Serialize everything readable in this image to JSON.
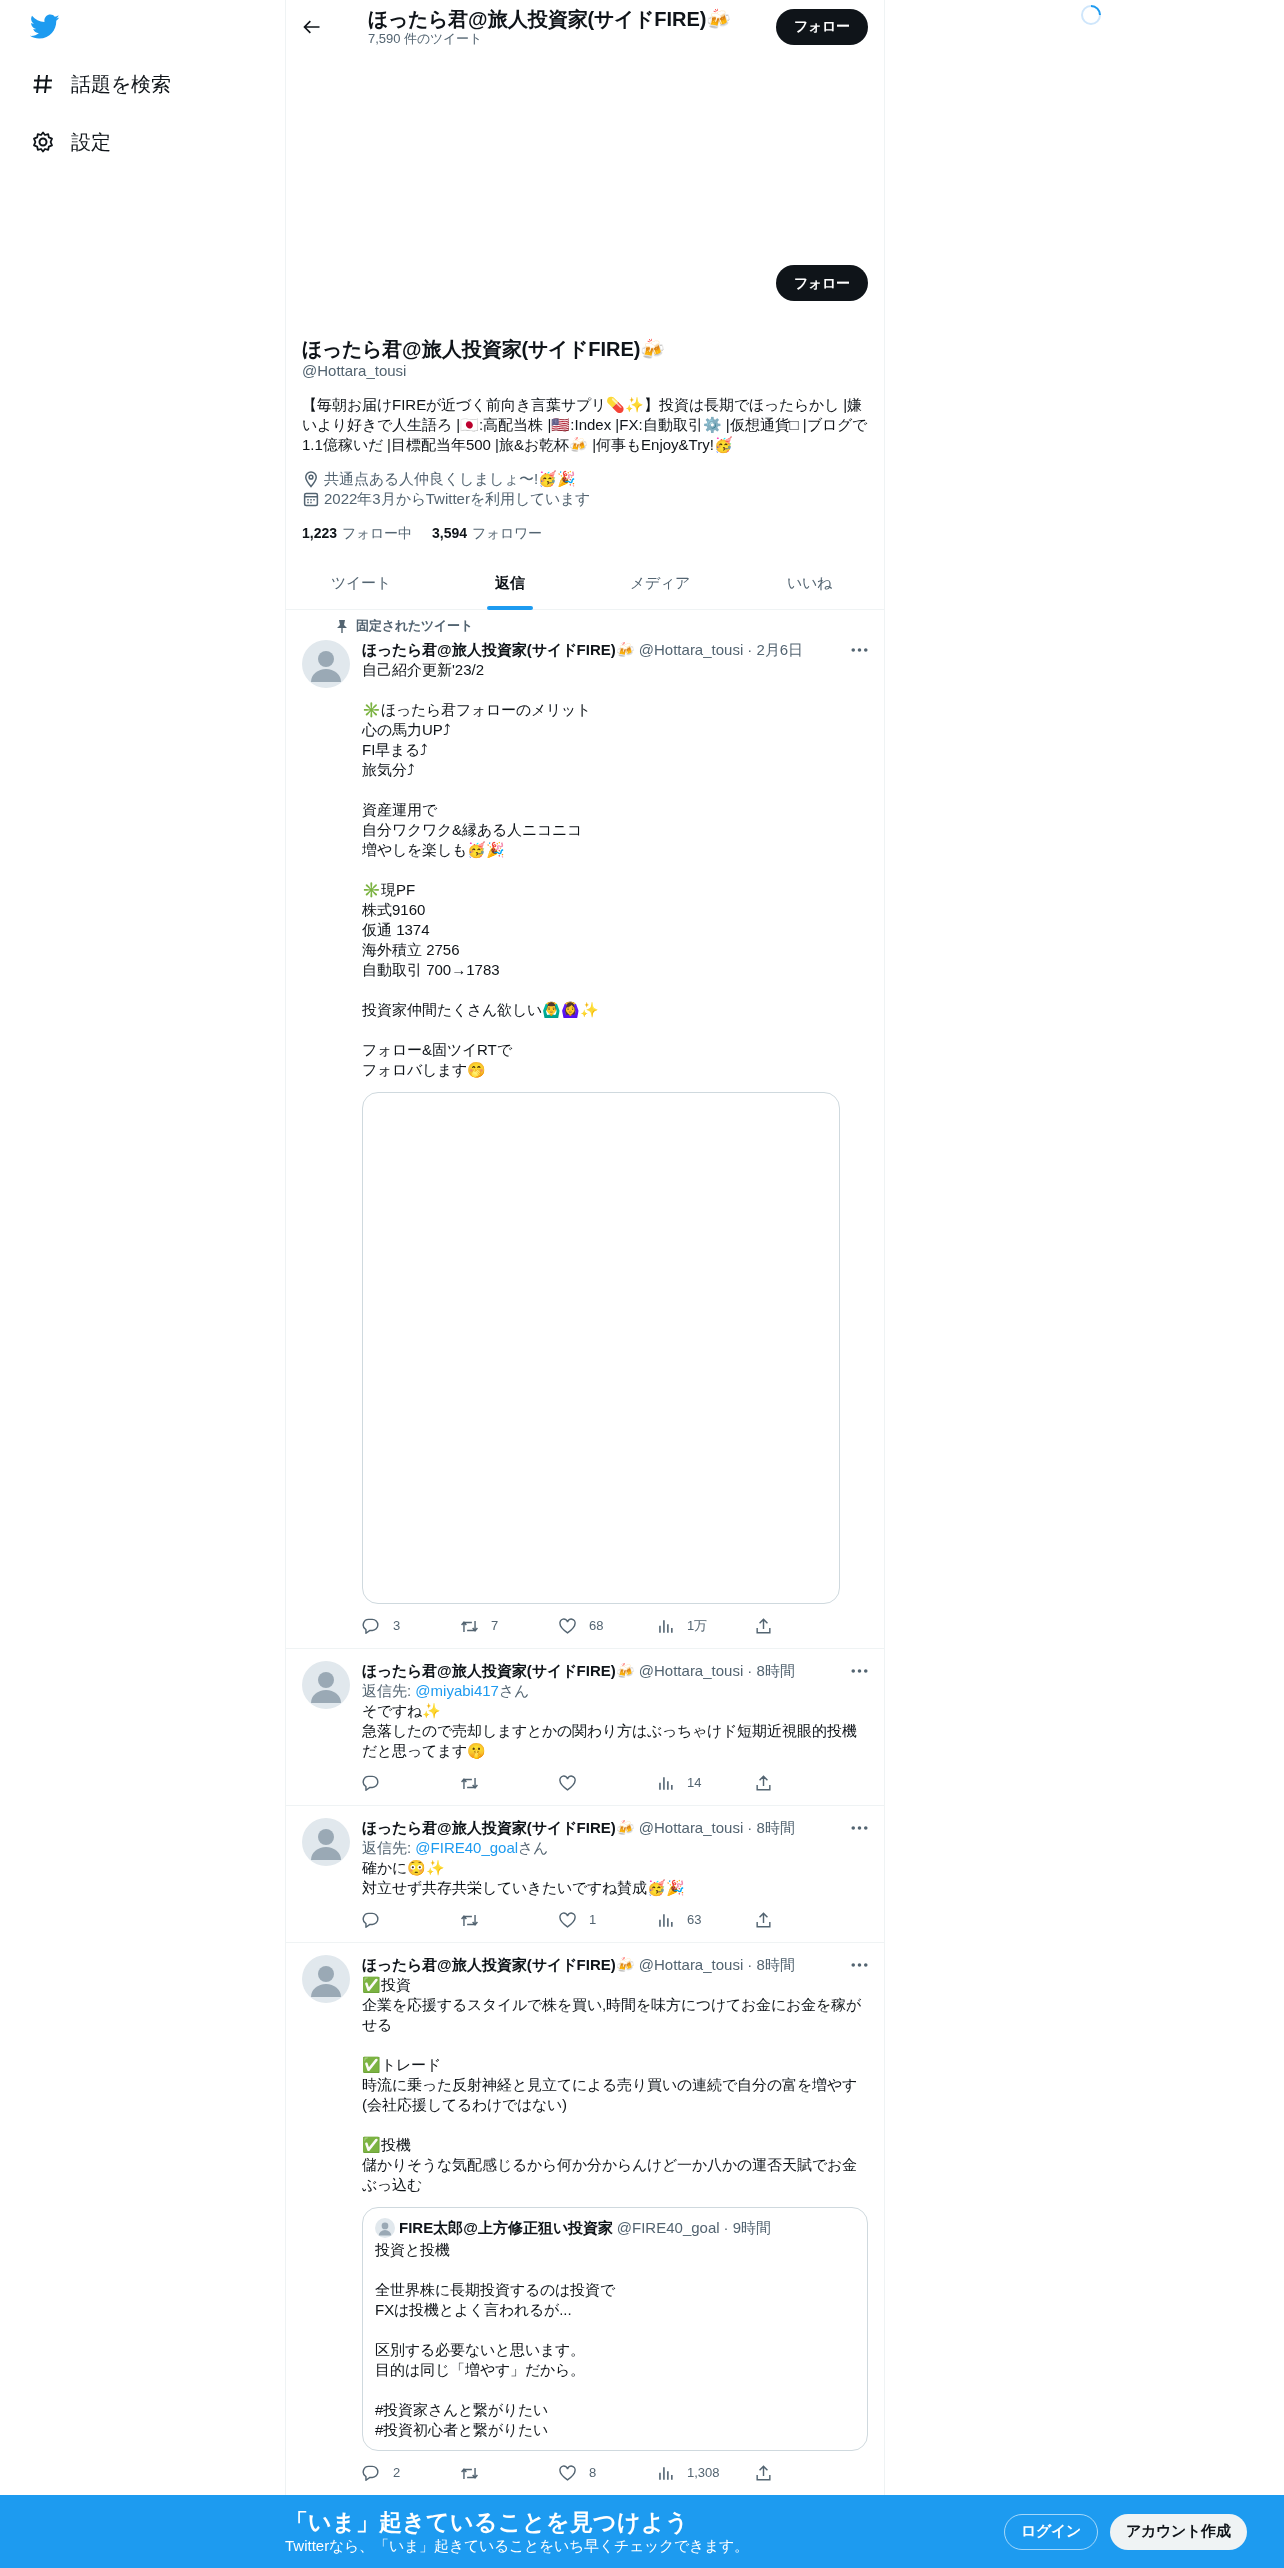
{
  "sidebar": {
    "items": [
      {
        "kind": "hashtag",
        "label": "話題を検索"
      },
      {
        "kind": "settings",
        "label": "設定"
      }
    ]
  },
  "header": {
    "title": "ほったら君@旅人投資家(サイドFIRE)🍻",
    "tweet_count": "7,590 件のツイート",
    "follow_button": "フォロー"
  },
  "profile": {
    "follow_button": "フォロー",
    "name": "ほったら君@旅人投資家(サイドFIRE)🍻",
    "handle": "@Hottara_tousi",
    "bio": "【毎朝お届けFIREが近づく前向き言葉サプリ💊✨】投資は長期でほったらかし |嫌いより好きで人生語ろ |🇯🇵:高配当株 |🇺🇸:Index |FX:自動取引⚙️ |仮想通貨□ |ブログで1.1億稼いだ |目標配当年500 |旅&お乾杯🍻 |何事もEnjoy&Try!🥳",
    "location": "共通点ある人仲良くしましょ〜!🥳🎉",
    "joined": "2022年3月からTwitterを利用しています",
    "following": {
      "count": "1,223",
      "label": "フォロー中"
    },
    "followers": {
      "count": "3,594",
      "label": "フォロワー"
    }
  },
  "tabs": [
    {
      "label": "ツイート",
      "selected": false
    },
    {
      "label": "返信",
      "selected": true
    },
    {
      "label": "メディア",
      "selected": false
    },
    {
      "label": "いいね",
      "selected": false
    }
  ],
  "tweets": [
    {
      "pinned": "固定されたツイート",
      "name": "ほったら君@旅人投資家(サイドFIRE)🍻",
      "handle": "@Hottara_tousi",
      "time": "· 2月6日",
      "text": [
        [
          "自己紹介更新'23/2"
        ],
        [
          "✳️ほったら君フォローのメリット",
          "心の馬力UP⤴",
          "FI早まる⤴",
          "旅気分⤴"
        ],
        [
          "資産運用で",
          "自分ワクワク&縁ある人ニコニコ",
          "増やしを楽しも🥳🎉"
        ],
        [
          "✳️現PF",
          "株式9160",
          "仮通 1374",
          "海外積立 2756",
          "自動取引 700→1783"
        ],
        [
          "投資家仲間たくさん欲しい🙆‍♂️🙆‍♀️✨"
        ],
        [
          "フォロー&固ツイRTで",
          "フォロバします🤭"
        ]
      ],
      "media": {
        "kind": "card"
      },
      "actions": [
        {
          "kind": "reply",
          "count": "3"
        },
        {
          "kind": "retweet",
          "count": "7"
        },
        {
          "kind": "like",
          "count": "68"
        },
        {
          "kind": "views",
          "count": "1万"
        },
        {
          "kind": "share"
        }
      ]
    },
    {
      "name": "ほったら君@旅人投資家(サイドFIRE)🍻",
      "handle": "@Hottara_tousi",
      "time": "· 8時間",
      "reply_to": {
        "prefix": "返信先: ",
        "handle": "@miyabi417",
        "suffix": "さん"
      },
      "text": [
        [
          "そですね✨",
          "急落したので売却しますとかの関わり方はぶっちゃけド短期近視眼的投機だと思ってます🤫"
        ]
      ],
      "actions": [
        {
          "kind": "reply"
        },
        {
          "kind": "retweet"
        },
        {
          "kind": "like"
        },
        {
          "kind": "views",
          "count": "14"
        },
        {
          "kind": "share"
        }
      ]
    },
    {
      "name": "ほったら君@旅人投資家(サイドFIRE)🍻",
      "handle": "@Hottara_tousi",
      "time": "· 8時間",
      "reply_to": {
        "prefix": "返信先: ",
        "handle": "@FIRE40_goal",
        "suffix": "さん"
      },
      "text": [
        [
          "確かに😳✨",
          "対立せず共存共栄していきたいですね賛成🥳🎉"
        ]
      ],
      "actions": [
        {
          "kind": "reply"
        },
        {
          "kind": "retweet"
        },
        {
          "kind": "like",
          "count": "1"
        },
        {
          "kind": "views",
          "count": "63"
        },
        {
          "kind": "share"
        }
      ]
    },
    {
      "name": "ほったら君@旅人投資家(サイドFIRE)🍻",
      "handle": "@Hottara_tousi",
      "time": "· 8時間",
      "text": [
        [
          "✅投資",
          "企業を応援するスタイルで株を買い,時間を味方につけてお金にお金を稼がせる"
        ],
        [
          "✅トレード",
          "時流に乗った反射神経と見立てによる売り買いの連続で自分の富を増やす(会社応援してるわけではない)"
        ],
        [
          "✅投機",
          "儲かりそうな気配感じるから何か分からんけど一か八かの運否天賦でお金ぶっ込む"
        ]
      ],
      "quote": {
        "name": "FIRE太郎@上方修正狙い投資家",
        "handle": "@FIRE40_goal",
        "time": "· 9時間",
        "text": [
          [
            "投資と投機"
          ],
          [
            "全世界株に長期投資するのは投資で",
            "FXは投機とよく言われるが..."
          ],
          [
            "区別する必要ないと思います。",
            "目的は同じ「増やす」だから。"
          ],
          [
            "#投資家さんと繋がりたい",
            "#投資初心者と繋がりたい"
          ]
        ]
      },
      "actions": [
        {
          "kind": "reply",
          "count": "2"
        },
        {
          "kind": "retweet"
        },
        {
          "kind": "like",
          "count": "8"
        },
        {
          "kind": "views",
          "count": "1,308"
        },
        {
          "kind": "share"
        }
      ]
    }
  ],
  "banner": {
    "title": "「いま」起きていることを見つけよう",
    "subtitle": "Twitterなら、「いま」起きていることをいち早くチェックできます。",
    "login": "ログイン",
    "signup": "アカウント作成"
  }
}
